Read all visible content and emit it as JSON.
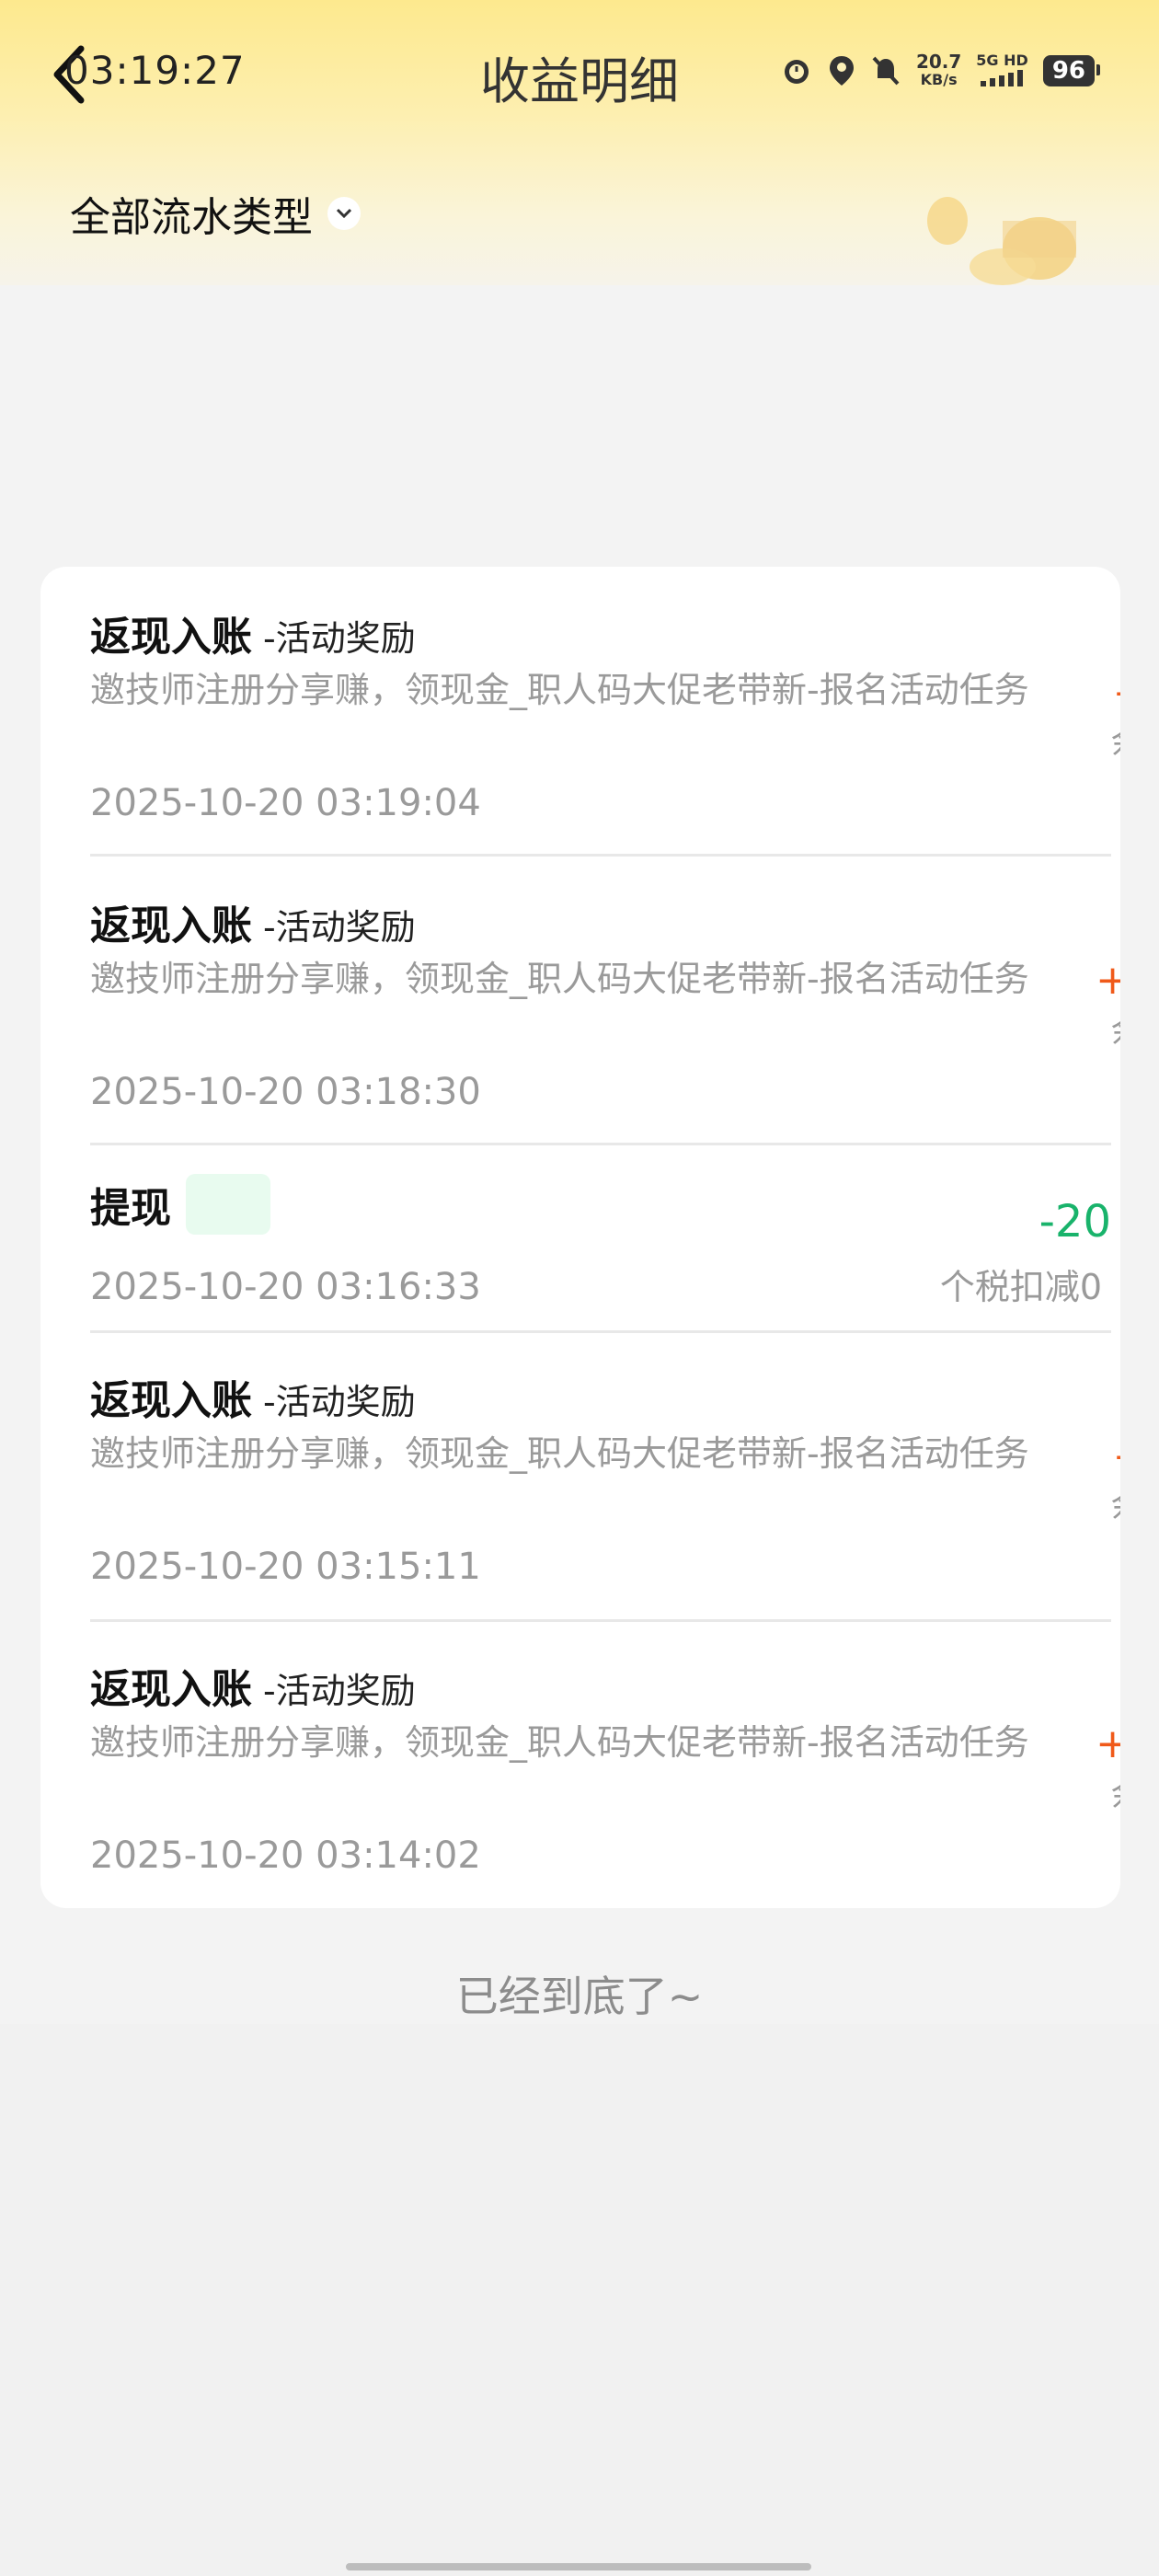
{
  "status_bar": {
    "time": "03:19:27",
    "net_speed": "20.7",
    "net_unit": "KB/s",
    "net_type": "5G HD",
    "battery": "96"
  },
  "header": {
    "title": "收益明细",
    "filter_label": "全部流水类型"
  },
  "records": [
    {
      "type": "返现入账",
      "subtype": "-活动奖励",
      "description": "邀技师注册分享赚，领现金_职人码大促老带新-报名活动任务",
      "time": "2025-10-20 03:19:04",
      "amount": "-",
      "balance_label": "余额"
    },
    {
      "type": "返现入账",
      "subtype": "-活动奖励",
      "description": "邀技师注册分享赚，领现金_职人码大促老带新-报名活动任务",
      "time": "2025-10-20 03:18:30",
      "amount": "+",
      "balance_label": "余额"
    },
    {
      "type": "提现",
      "time": "2025-10-20 03:16:33",
      "amount": "-20",
      "tax_note": "个税扣减0"
    },
    {
      "type": "返现入账",
      "subtype": "-活动奖励",
      "description": "邀技师注册分享赚，领现金_职人码大促老带新-报名活动任务",
      "time": "2025-10-20 03:15:11",
      "amount": "-",
      "balance_label": "余额"
    },
    {
      "type": "返现入账",
      "subtype": "-活动奖励",
      "description": "邀技师注册分享赚，领现金_职人码大促老带新-报名活动任务",
      "time": "2025-10-20 03:14:02",
      "amount": "+",
      "balance_label": "余额"
    }
  ],
  "footer": {
    "end_text": "已经到底了~"
  },
  "colors": {
    "income": "#f05a1a",
    "withdraw": "#19b36b",
    "header_gradient_top": "#fde98e"
  }
}
